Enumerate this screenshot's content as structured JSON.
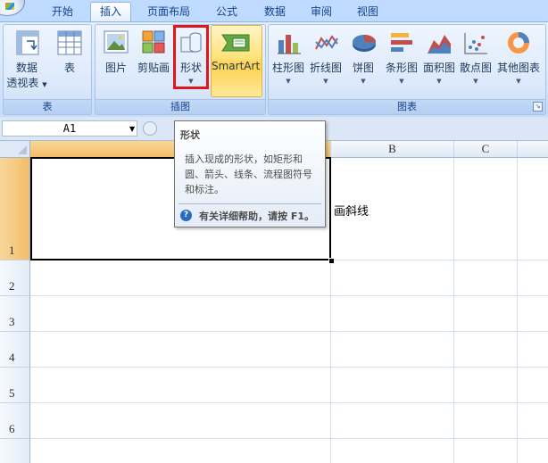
{
  "ribbon": {
    "tabs": [
      {
        "label": "开始"
      },
      {
        "label": "插入"
      },
      {
        "label": "页面布局"
      },
      {
        "label": "公式"
      },
      {
        "label": "数据"
      },
      {
        "label": "审阅"
      },
      {
        "label": "视图"
      }
    ],
    "active_tab": "插入",
    "groups": {
      "tables": {
        "label": "表",
        "pivot_label_line1": "数据",
        "pivot_label_line2": "透视表",
        "table_label": "表"
      },
      "illustrations": {
        "label": "插图",
        "picture_label": "图片",
        "clipart_label": "剪贴画",
        "shapes_label": "形状",
        "smartart_label": "SmartArt"
      },
      "charts": {
        "label": "图表",
        "items": [
          {
            "label": "柱形图",
            "icon": "column-chart-icon"
          },
          {
            "label": "折线图",
            "icon": "line-chart-icon"
          },
          {
            "label": "饼图",
            "icon": "pie-chart-icon"
          },
          {
            "label": "条形图",
            "icon": "bar-chart-icon"
          },
          {
            "label": "面积图",
            "icon": "area-chart-icon"
          },
          {
            "label": "散点图",
            "icon": "scatter-chart-icon"
          },
          {
            "label": "其他图表",
            "icon": "other-chart-icon"
          }
        ]
      }
    }
  },
  "formula_bar": {
    "name_box": "A1"
  },
  "sheet": {
    "columns": [
      "B",
      "C"
    ],
    "rows": [
      "1",
      "2",
      "3",
      "4",
      "5",
      "6"
    ],
    "cell_text": "画斜线"
  },
  "tooltip": {
    "title": "形状",
    "body": "插入现成的形状，如矩形和圆、箭头、线条、流程图符号和标注。",
    "help": "有关详细帮助，请按 F1。"
  },
  "colors": {
    "ribbon_bg": "#dbe8fb",
    "active_row_header": "#f3bd68",
    "highlight_box": "#e0161c"
  }
}
